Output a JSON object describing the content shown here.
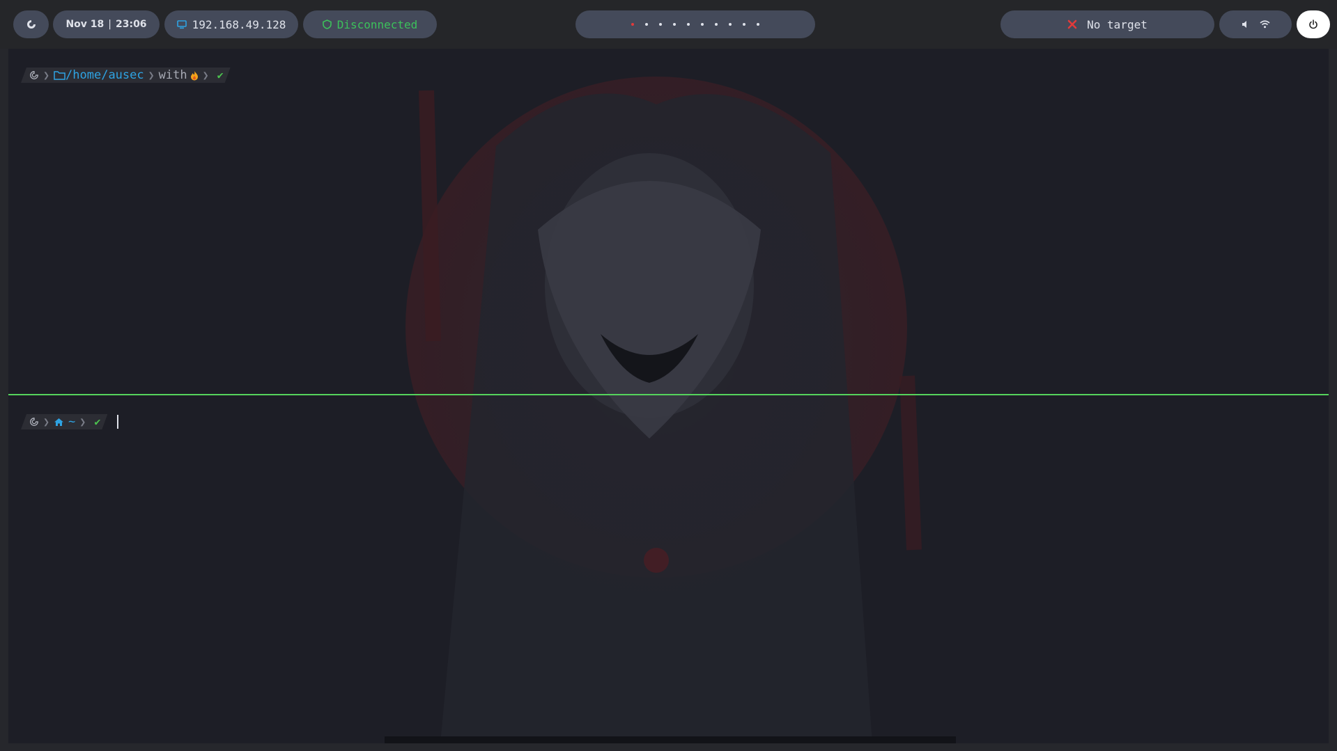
{
  "topbar": {
    "launcher_icon": "debian-swirl-icon",
    "date": "Nov 18",
    "time": "23:06",
    "ip_icon": "monitor-icon",
    "ip": "192.168.49.128",
    "vpn_icon": "shield-icon",
    "vpn_status": "Disconnected",
    "workspaces_count": 10,
    "active_workspace": 1,
    "target_icon": "x-icon",
    "target": "No target",
    "volume_icon": "speaker-icon",
    "wifi_icon": "wifi-icon",
    "power_icon": "power-icon"
  },
  "terminal": {
    "top": {
      "os_icon": "debian-swirl-icon",
      "path": "/home/ausec",
      "word": "with",
      "status_icon": "check-icon"
    },
    "bottom": {
      "os_icon": "debian-swirl-icon",
      "path": "~",
      "status_icon": "check-icon"
    }
  },
  "colors": {
    "accent_green": "#55d45c",
    "path_blue": "#2ea3e3",
    "error_red": "#e23a3a",
    "pill_bg": "#444a5a"
  }
}
